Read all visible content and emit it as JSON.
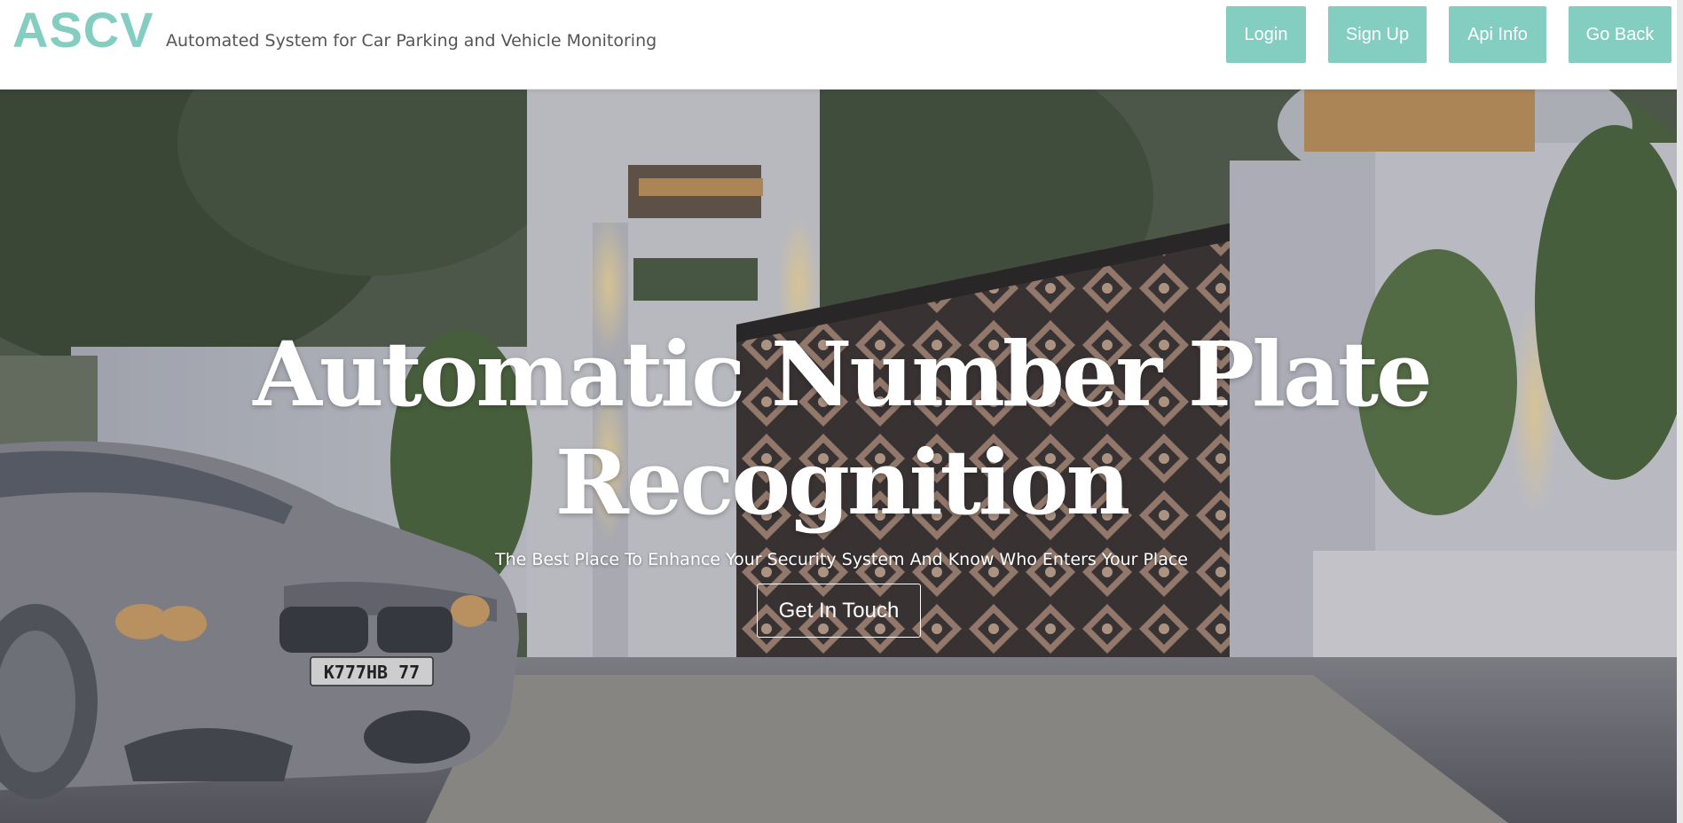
{
  "header": {
    "logo": "ASCV",
    "tagline": "Automated System for Car Parking and Vehicle Monitoring",
    "nav": {
      "login": "Login",
      "signup": "Sign Up",
      "api_info": "Api Info",
      "go_back": "Go Back"
    }
  },
  "hero": {
    "title_line1": "Automatic Number Plate",
    "title_line2": "Recognition",
    "subtitle": "The Best Place To Enhance Your Security System And Know Who Enters Your Place",
    "cta_label": "Get In Touch",
    "plate_text": "K777HB 77"
  },
  "colors": {
    "accent": "#83cdc1",
    "white": "#ffffff",
    "tagline": "#555555"
  }
}
